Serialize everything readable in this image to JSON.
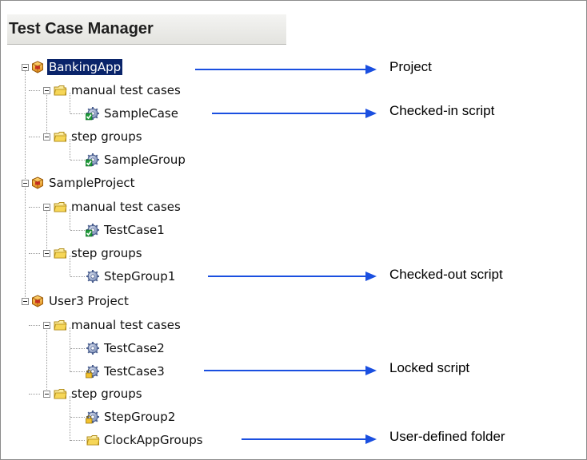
{
  "panel": {
    "title": "Test Case Manager"
  },
  "tree": [
    {
      "label": "BankingApp",
      "selected": true
    },
    {
      "label": "manual test cases"
    },
    {
      "label": "SampleCase"
    },
    {
      "label": "step groups"
    },
    {
      "label": "SampleGroup"
    },
    {
      "label": "SampleProject"
    },
    {
      "label": "manual test cases"
    },
    {
      "label": "TestCase1"
    },
    {
      "label": "step groups"
    },
    {
      "label": "StepGroup1"
    },
    {
      "label": "User3 Project"
    },
    {
      "label": "manual test cases"
    },
    {
      "label": "TestCase2"
    },
    {
      "label": "TestCase3"
    },
    {
      "label": "step groups"
    },
    {
      "label": "StepGroup2"
    },
    {
      "label": "ClockAppGroups"
    }
  ],
  "callouts": {
    "project": "Project",
    "checked_in": "Checked-in script",
    "checked_out": "Checked-out script",
    "locked": "Locked script",
    "user_folder": "User-defined folder"
  },
  "colors": {
    "arrow": "#1a4fe0",
    "selection": "#0a246a"
  }
}
